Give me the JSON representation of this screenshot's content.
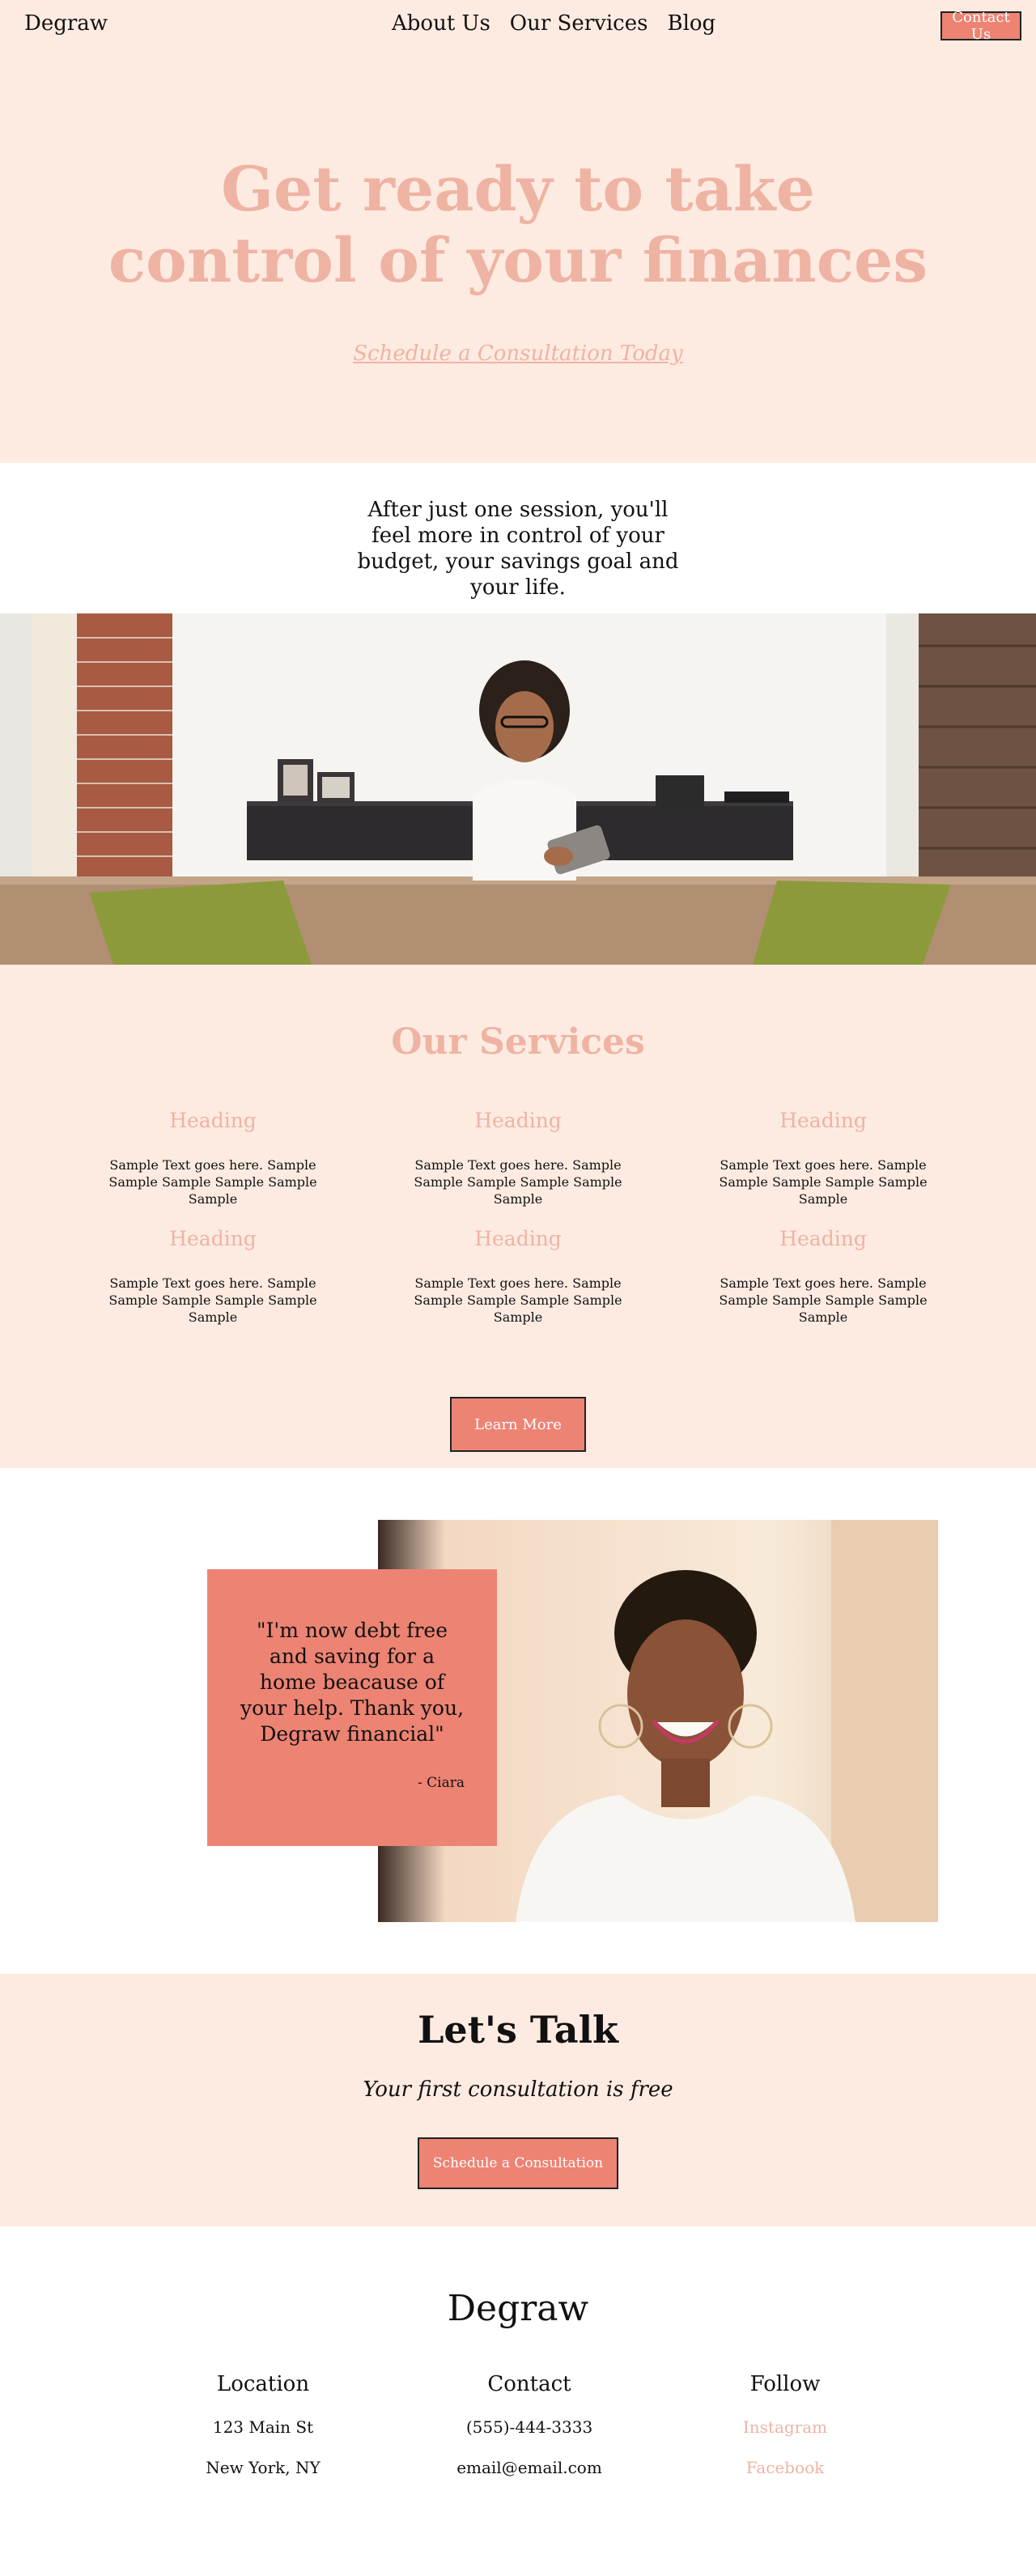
{
  "nav": {
    "brand": "Degraw",
    "links": [
      "About Us",
      "Our Services",
      "Blog"
    ],
    "contact_label": "Contact Us"
  },
  "hero": {
    "title_line1": "Get ready to take",
    "title_line2": "control of your finances",
    "cta": "Schedule a Consultation Today"
  },
  "intro": {
    "text": "After just one session, you'll feel more in control of your budget, your savings goal and your life."
  },
  "services": {
    "title": "Our Services",
    "items": [
      {
        "heading": "Heading",
        "text": "Sample Text goes here. Sample Sample Sample Sample Sample Sample"
      },
      {
        "heading": "Heading",
        "text": "Sample Text goes here. Sample Sample Sample Sample Sample Sample"
      },
      {
        "heading": "Heading",
        "text": "Sample Text goes here. Sample Sample Sample Sample Sample Sample"
      },
      {
        "heading": "Heading",
        "text": "Sample Text goes here. Sample Sample Sample Sample Sample Sample"
      },
      {
        "heading": "Heading",
        "text": "Sample Text goes here. Sample Sample Sample Sample Sample Sample"
      },
      {
        "heading": "Heading",
        "text": "Sample Text goes here. Sample Sample Sample Sample Sample Sample"
      }
    ],
    "button_label": "Learn More"
  },
  "testimonial": {
    "quote": "\"I'm now debt free and saving for a home beacause of your help. Thank you, Degraw financial\"",
    "author": "- Ciara"
  },
  "talk": {
    "title": "Let's Talk",
    "subtitle": "Your first consultation is free",
    "button_label": "Schedule a Consultation"
  },
  "footer": {
    "brand": "Degraw",
    "location": {
      "heading": "Location",
      "line1": "123 Main St",
      "line2": "New York, NY"
    },
    "contact": {
      "heading": "Contact",
      "phone": "(555)-444-3333",
      "email": "email@email.com"
    },
    "follow": {
      "heading": "Follow",
      "link1": "Instagram",
      "link2": "Facebook"
    }
  },
  "colors": {
    "peach_bg": "#fdebe1",
    "pink_text": "#efb3a3",
    "coral": "#ed8373"
  }
}
